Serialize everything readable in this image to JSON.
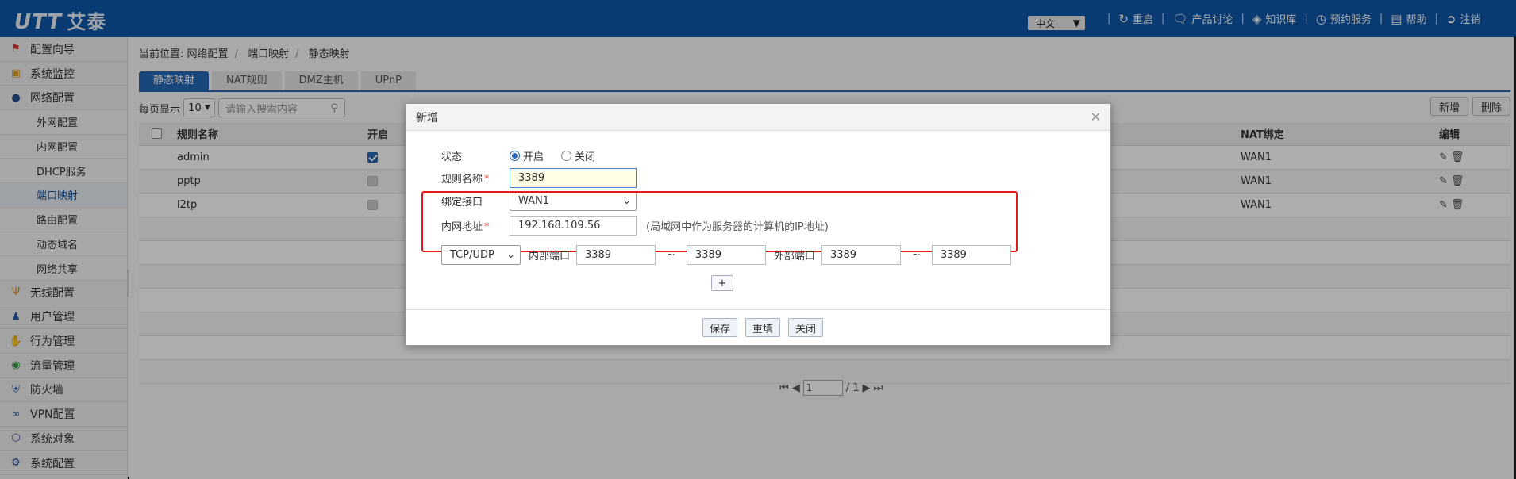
{
  "app": {
    "logo_mark": "UTT",
    "logo_text": "艾泰",
    "brand_color": "#0f56a8"
  },
  "topbar": {
    "language": "中文",
    "links": [
      {
        "label": "重启",
        "icon": "restart-icon"
      },
      {
        "label": "产品讨论",
        "icon": "chat-icon"
      },
      {
        "label": "知识库",
        "icon": "book-icon"
      },
      {
        "label": "预约服务",
        "icon": "clock-icon"
      },
      {
        "label": "帮助",
        "icon": "help-icon"
      },
      {
        "label": "注销",
        "icon": "logout-icon"
      }
    ]
  },
  "sidebar": {
    "items": [
      {
        "label": "配置向导",
        "icon": "wizard-icon"
      },
      {
        "label": "系统监控",
        "icon": "monitor-icon"
      },
      {
        "label": "网络配置",
        "icon": "globe-icon"
      },
      {
        "label": "外网配置",
        "sub": true
      },
      {
        "label": "内网配置",
        "sub": true
      },
      {
        "label": "DHCP服务",
        "sub": true
      },
      {
        "label": "端口映射",
        "sub": true,
        "active": true
      },
      {
        "label": "路由配置",
        "sub": true
      },
      {
        "label": "动态域名",
        "sub": true
      },
      {
        "label": "网络共享",
        "sub": true
      },
      {
        "label": "无线配置",
        "icon": "wireless-icon"
      },
      {
        "label": "用户管理",
        "icon": "users-icon"
      },
      {
        "label": "行为管理",
        "icon": "hand-icon"
      },
      {
        "label": "流量管理",
        "icon": "traffic-icon"
      },
      {
        "label": "防火墙",
        "icon": "shield-icon"
      },
      {
        "label": "VPN配置",
        "icon": "vpn-icon"
      },
      {
        "label": "系统对象",
        "icon": "cube-icon"
      },
      {
        "label": "系统配置",
        "icon": "gear-icon"
      }
    ]
  },
  "breadcrumb": {
    "prefix": "当前位置:",
    "parts": [
      "网络配置",
      "端口映射",
      "静态映射"
    ]
  },
  "tabs": [
    "静态映射",
    "NAT规则",
    "DMZ主机",
    "UPnP"
  ],
  "toolbar": {
    "per_page_label": "每页显示",
    "per_page_value": "10",
    "search_placeholder": "请输入搜索内容",
    "add_label": "新增",
    "delete_label": "删除"
  },
  "table": {
    "headers": {
      "name": "规则名称",
      "enabled": "开启",
      "nat": "NAT绑定",
      "edit": "编辑"
    },
    "rows": [
      {
        "name": "admin",
        "enabled": true,
        "disabled": false,
        "nat": "WAN1"
      },
      {
        "name": "pptp",
        "enabled": true,
        "disabled": true,
        "nat": "WAN1"
      },
      {
        "name": "l2tp",
        "enabled": true,
        "disabled": true,
        "nat": "WAN1"
      }
    ]
  },
  "pager": {
    "page": "1",
    "total": "/ 1"
  },
  "modal": {
    "title": "新增",
    "status_label": "状态",
    "status_on": "开启",
    "status_off": "关闭",
    "rule_name_label": "规则名称",
    "rule_name_value": "3389",
    "bind_label": "绑定接口",
    "bind_value": "WAN1",
    "ip_label": "内网地址",
    "ip_value": "192.168.109.56",
    "ip_hint": "(局域网中作为服务器的计算机的IP地址)",
    "protocol": "TCP/UDP",
    "inner_port_label": "内部端口",
    "inner_port_start": "3389",
    "inner_port_end": "3389",
    "tilde": "~",
    "outer_port_label": "外部端口",
    "outer_port_start": "3389",
    "outer_port_end": "3389",
    "plus_label": "+",
    "save_label": "保存",
    "reset_label": "重填",
    "close_label": "关闭"
  }
}
